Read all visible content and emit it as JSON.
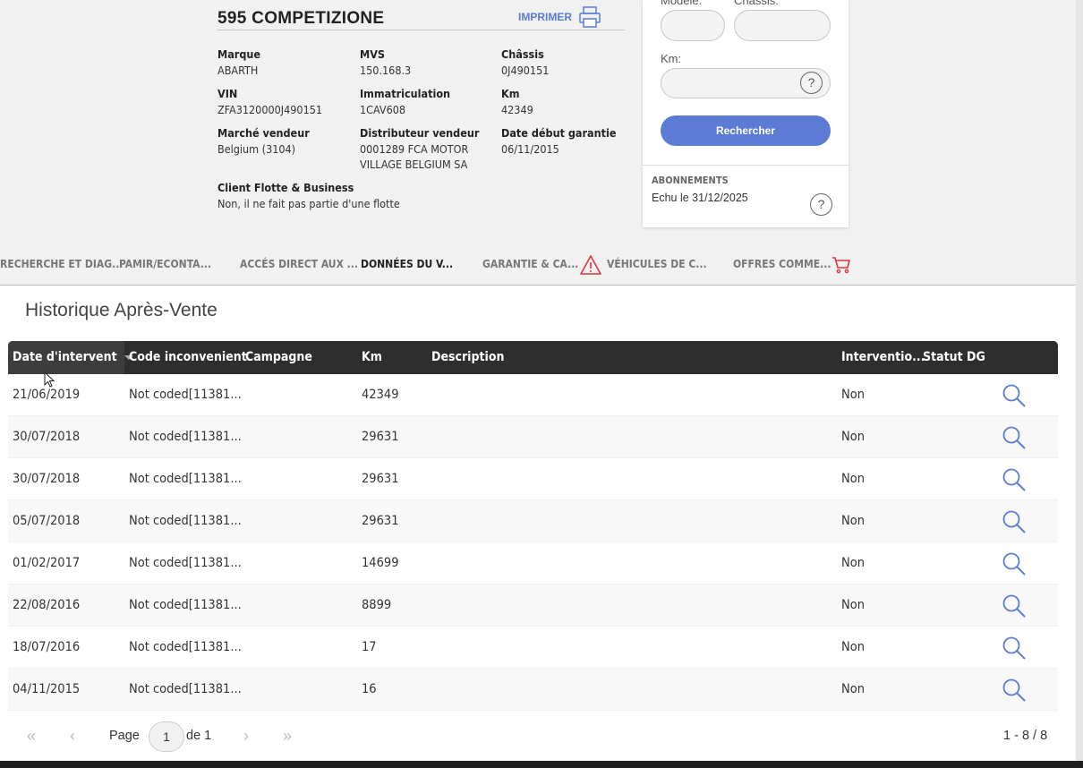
{
  "vehicle": {
    "title": "595 COMPETIZIONE",
    "print_label": "IMPRIMER",
    "fields": {
      "marque": {
        "label": "Marque",
        "value": "ABARTH"
      },
      "mvs": {
        "label": "MVS",
        "value": "150.168.3"
      },
      "chassis": {
        "label": "Châssis",
        "value": "0J490151"
      },
      "vin": {
        "label": "VIN",
        "value": "ZFA3120000J490151"
      },
      "immat": {
        "label": "Immatriculation",
        "value": "1CAV608"
      },
      "km": {
        "label": "Km",
        "value": "42349"
      },
      "marche": {
        "label": "Marché vendeur",
        "value": "Belgium (3104)"
      },
      "distributeur": {
        "label": "Distributeur vendeur",
        "value_line1": "0001289 FCA MOTOR",
        "value_line2": "VILLAGE BELGIUM SA"
      },
      "garantie": {
        "label": "Date début garantie",
        "value": "06/11/2015"
      },
      "flotte": {
        "label": "Client Flotte & Business",
        "value": "Non, il ne fait pas partie d'une flotte"
      }
    }
  },
  "search_panel": {
    "modele_label": "Modèle:",
    "chassis_label": "Châssis:",
    "km_label": "Km:",
    "search_button": "Rechercher",
    "subscriptions_title": "ABONNEMENTS",
    "subscriptions_text": "Echu le 31/12/2025"
  },
  "tabs": [
    {
      "label": "RECHERCHE ET DIAG..."
    },
    {
      "label": "PAMIR/ECONTA..."
    },
    {
      "label": "ACCÉS DIRECT AUX ..."
    },
    {
      "label": "DONNÉES DU V..."
    },
    {
      "label": "GARANTIE & CA..."
    },
    {
      "label": "VÉHICULES DE C..."
    },
    {
      "label": "OFFRES COMME..."
    }
  ],
  "history": {
    "title": "Historique Après-Vente",
    "columns": [
      "Date d'intervent",
      "Code inconvenient",
      "Campagne",
      "Km",
      "Description",
      "Interventio...",
      "Statut DG"
    ],
    "rows": [
      {
        "date": "21/06/2019",
        "code": "Not coded[11381...",
        "campagne": "",
        "km": "42349",
        "description": "",
        "intervention": "Non",
        "statut": ""
      },
      {
        "date": "30/07/2018",
        "code": "Not coded[11381...",
        "campagne": "",
        "km": "29631",
        "description": "",
        "intervention": "Non",
        "statut": ""
      },
      {
        "date": "30/07/2018",
        "code": "Not coded[11381...",
        "campagne": "",
        "km": "29631",
        "description": "",
        "intervention": "Non",
        "statut": ""
      },
      {
        "date": "05/07/2018",
        "code": "Not coded[11381...",
        "campagne": "",
        "km": "29631",
        "description": "",
        "intervention": "Non",
        "statut": ""
      },
      {
        "date": "01/02/2017",
        "code": "Not coded[11381...",
        "campagne": "",
        "km": "14699",
        "description": "",
        "intervention": "Non",
        "statut": ""
      },
      {
        "date": "22/08/2016",
        "code": "Not coded[11381...",
        "campagne": "",
        "km": "8899",
        "description": "",
        "intervention": "Non",
        "statut": ""
      },
      {
        "date": "18/07/2016",
        "code": "Not coded[11381...",
        "campagne": "",
        "km": "17",
        "description": "",
        "intervention": "Non",
        "statut": ""
      },
      {
        "date": "04/11/2015",
        "code": "Not coded[11381...",
        "campagne": "",
        "km": "16",
        "description": "",
        "intervention": "Non",
        "statut": ""
      }
    ]
  },
  "pager": {
    "page_label": "Page",
    "current_page": "1",
    "of_label": "de 1",
    "range": "1 - 8 / 8"
  },
  "colors": {
    "accent": "#5b7bd5",
    "header": "#2e2e2e",
    "warning": "#d9363e"
  }
}
